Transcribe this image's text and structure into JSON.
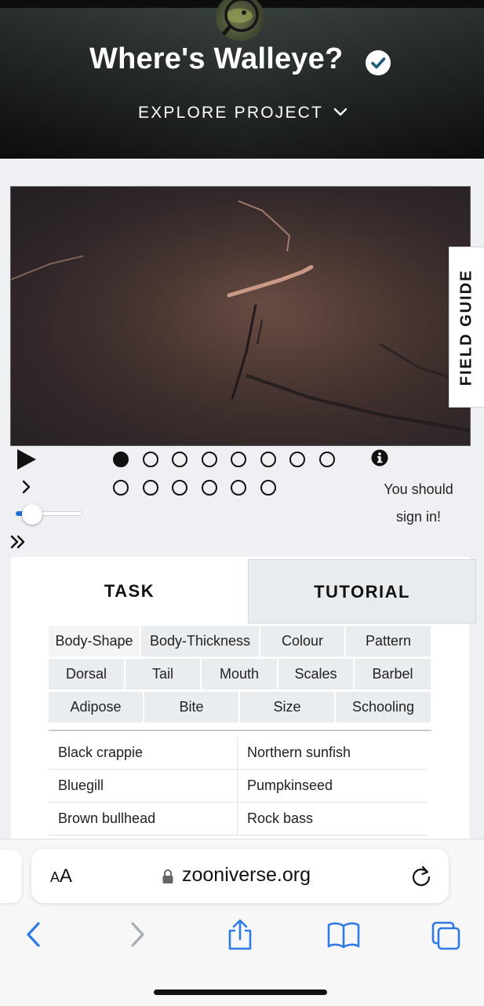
{
  "header": {
    "project_title": "Where's Walleye?",
    "explore_label": "EXPLORE PROJECT"
  },
  "field_guide": {
    "label": "FIELD GUIDE"
  },
  "player": {
    "frame_count": 14,
    "active_frame": 1,
    "playback_speed_fraction": 0.25,
    "sign_in_line1": "You should",
    "sign_in_line2": "sign in!"
  },
  "tabs": {
    "task": "TASK",
    "tutorial": "TUTORIAL"
  },
  "filters": {
    "row1": [
      "Body-Shape",
      "Body-Thickness",
      "Colour",
      "Pattern"
    ],
    "row2": [
      "Dorsal",
      "Tail",
      "Mouth",
      "Scales",
      "Barbel"
    ],
    "row3": [
      "Adipose",
      "Bite",
      "Size",
      "Schooling"
    ]
  },
  "species": [
    [
      "Black crappie",
      "Northern sunfish"
    ],
    [
      "Bluegill",
      "Pumpkinseed"
    ],
    [
      "Brown bullhead",
      "Rock bass"
    ]
  ],
  "browser": {
    "text_size_label_small": "A",
    "text_size_label_large": "A",
    "url": "zooniverse.org"
  },
  "colors": {
    "accent": "#1f6fd6",
    "verified_check": "#1b5e75",
    "page_background": "#eef0f3"
  },
  "icons": [
    "verified-check-icon",
    "chevron-down-icon",
    "play-icon",
    "step-forward-icon",
    "fast-forward-icon",
    "info-icon",
    "lock-icon",
    "reload-icon",
    "back-icon",
    "forward-icon",
    "share-icon",
    "bookmarks-icon",
    "tabs-icon"
  ]
}
